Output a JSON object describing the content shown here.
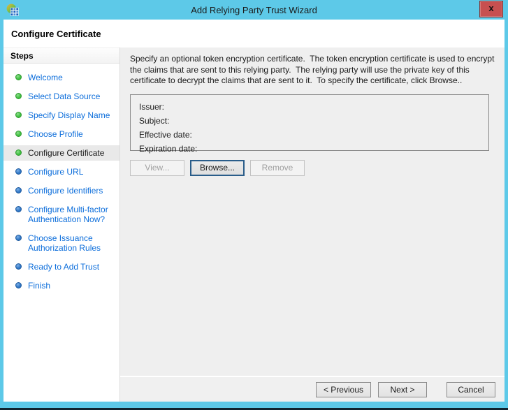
{
  "window": {
    "title": "Add Relying Party Trust Wizard",
    "close_glyph": "x"
  },
  "header": {
    "title": "Configure Certificate"
  },
  "sidebar": {
    "heading": "Steps",
    "items": [
      {
        "label": "Welcome",
        "status": "complete",
        "current": false
      },
      {
        "label": "Select Data Source",
        "status": "complete",
        "current": false
      },
      {
        "label": "Specify Display Name",
        "status": "complete",
        "current": false
      },
      {
        "label": "Choose Profile",
        "status": "complete",
        "current": false
      },
      {
        "label": "Configure Certificate",
        "status": "complete",
        "current": true
      },
      {
        "label": "Configure URL",
        "status": "upcoming",
        "current": false
      },
      {
        "label": "Configure Identifiers",
        "status": "upcoming",
        "current": false
      },
      {
        "label": "Configure Multi-factor Authentication Now?",
        "status": "upcoming",
        "current": false
      },
      {
        "label": "Choose Issuance Authorization Rules",
        "status": "upcoming",
        "current": false
      },
      {
        "label": "Ready to Add Trust",
        "status": "upcoming",
        "current": false
      },
      {
        "label": "Finish",
        "status": "upcoming",
        "current": false
      }
    ]
  },
  "content": {
    "description": "Specify an optional token encryption certificate.  The token encryption certificate is used to encrypt the claims that are sent to this relying party.  The relying party will use the private key of this certificate to decrypt the claims that are sent to it.  To specify the certificate, click Browse..",
    "certificate_fields": [
      {
        "label": "Issuer:",
        "value": ""
      },
      {
        "label": "Subject:",
        "value": ""
      },
      {
        "label": "Effective date:",
        "value": ""
      },
      {
        "label": "Expiration date:",
        "value": ""
      }
    ],
    "buttons": [
      {
        "label": "View...",
        "enabled": false
      },
      {
        "label": "Browse...",
        "enabled": true,
        "default": true
      },
      {
        "label": "Remove",
        "enabled": false
      }
    ]
  },
  "footer": {
    "buttons": [
      {
        "label": "< Previous"
      },
      {
        "label": "Next >"
      },
      {
        "label": "Cancel"
      }
    ]
  },
  "colors": {
    "titlebar": "#5dc9e8",
    "close_button": "#c75050",
    "panel_gray": "#efefef",
    "sidebar_white": "#ffffff",
    "current_step_highlight": "#e9e9e9",
    "step_link_blue": "#0d6edb",
    "bullet_complete_green": "#3fbf3f",
    "bullet_upcoming_blue": "#2e75c4",
    "default_button_border": "#2a5d8a"
  }
}
